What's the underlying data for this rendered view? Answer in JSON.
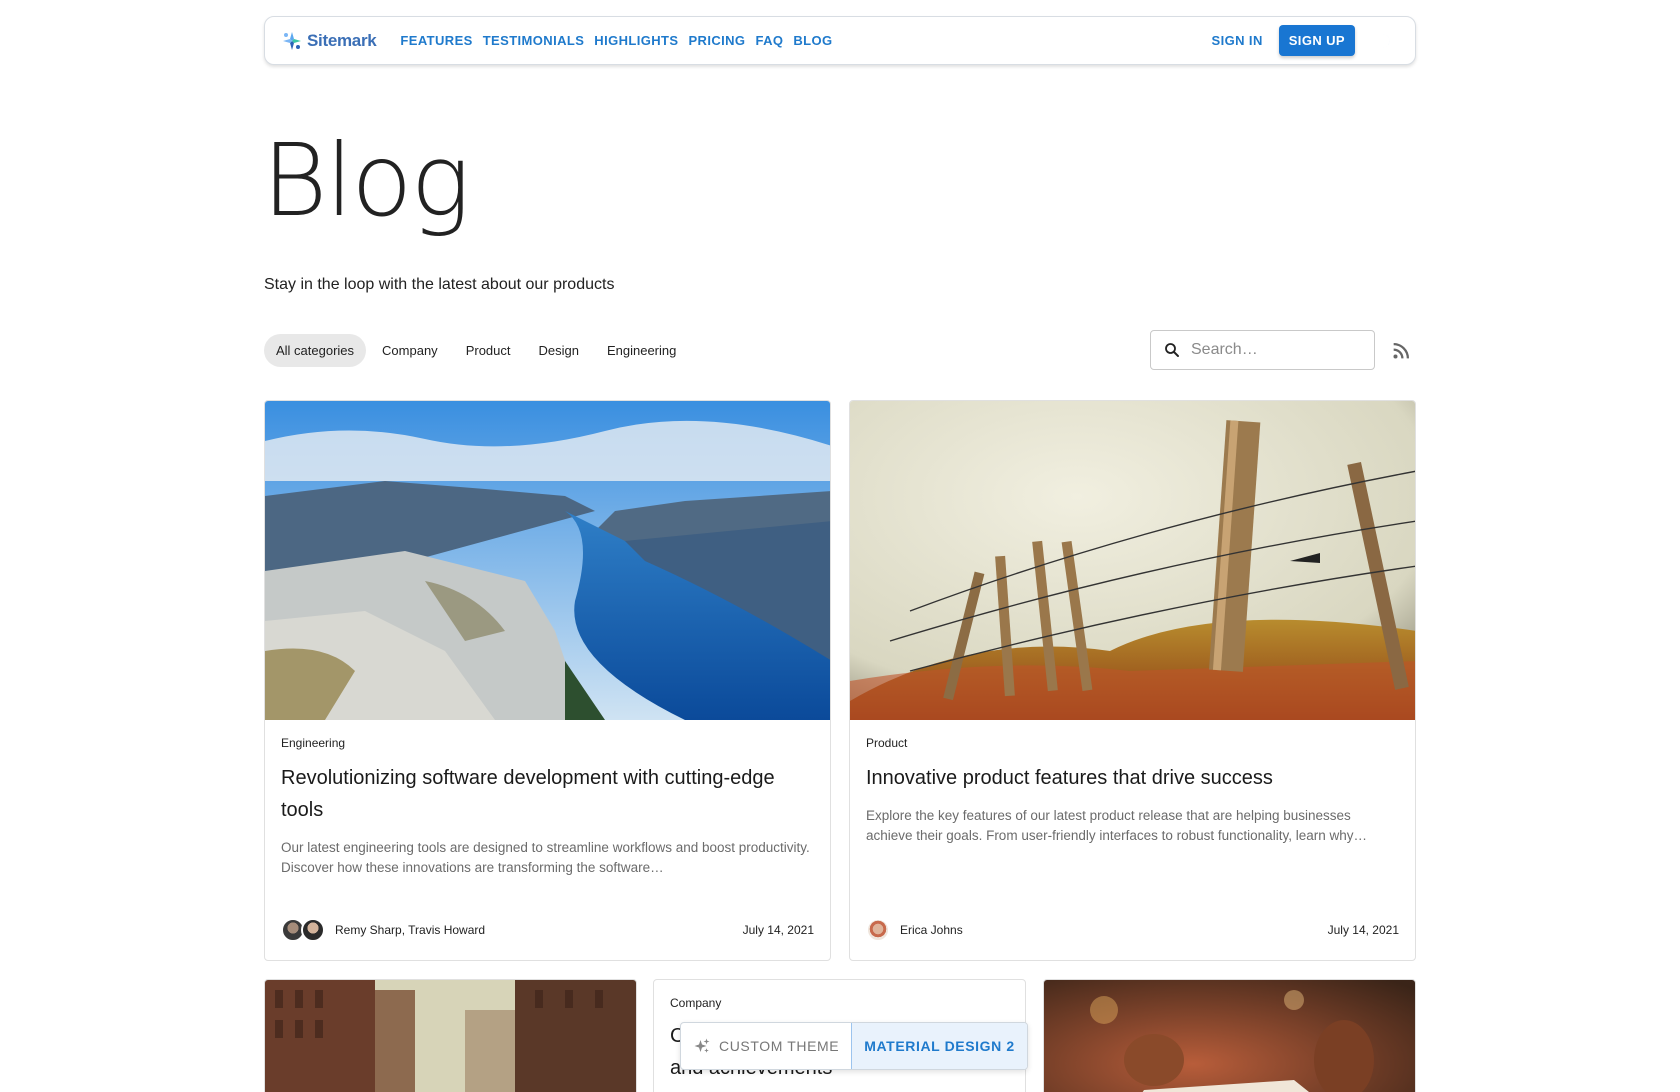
{
  "brand": {
    "logo_text": "Sitemark"
  },
  "nav": {
    "links": [
      "FEATURES",
      "TESTIMONIALS",
      "HIGHLIGHTS",
      "PRICING",
      "FAQ",
      "BLOG"
    ],
    "sign_in": "SIGN IN",
    "sign_up": "SIGN UP"
  },
  "header": {
    "title": "Blog",
    "subtitle": "Stay in the loop with the latest about our products"
  },
  "filters": {
    "categories": [
      "All categories",
      "Company",
      "Product",
      "Design",
      "Engineering"
    ],
    "active": "All categories",
    "search_placeholder": "Search…"
  },
  "posts": [
    {
      "category": "Engineering",
      "title": "Revolutionizing software development with cutting-edge tools",
      "description": "Our latest engineering tools are designed to streamline workflows and boost productivity. Discover how these innovations are transforming the software…",
      "authors": "Remy Sharp, Travis Howard",
      "date": "July 14, 2021"
    },
    {
      "category": "Product",
      "title": "Innovative product features that drive success",
      "description": "Explore the key features of our latest product release that are helping businesses achieve their goals. From user-friendly interfaces to robust functionality, learn why…",
      "authors": "Erica Johns",
      "date": "July 14, 2021"
    },
    {
      "category": "Company",
      "title_line1": "C",
      "title_line2": "and achievements"
    }
  ],
  "theme_switcher": {
    "custom": "CUSTOM THEME",
    "material": "MATERIAL DESIGN 2"
  },
  "colors": {
    "accent": "#1976d2",
    "link": "#1f7acc"
  }
}
